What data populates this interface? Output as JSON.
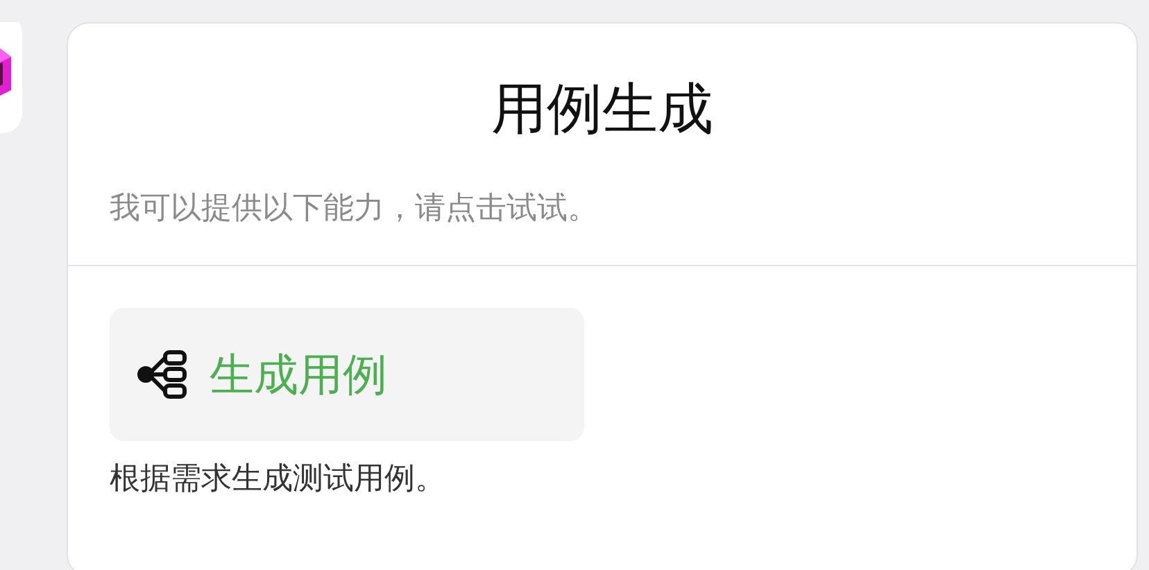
{
  "card": {
    "title": "用例生成",
    "subtitle": "我可以提供以下能力，请点击试试。",
    "actions": [
      {
        "label": "生成用例",
        "description": "根据需求生成测试用例。"
      }
    ]
  }
}
